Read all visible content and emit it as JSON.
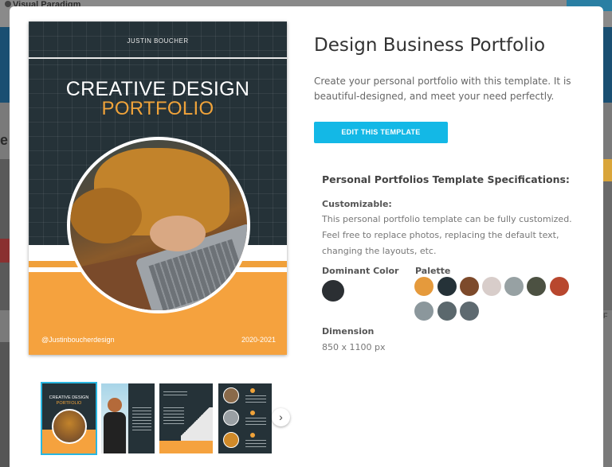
{
  "background": {
    "logo_text": "Visual Paradigm",
    "section_heading": "e",
    "right_card_label": "F"
  },
  "preview": {
    "author": "JUSTIN BOUCHER",
    "title_line1": "CREATIVE DESIGN",
    "title_line2": "PORTFOLIO",
    "handle": "@Justinboucherdesign",
    "year": "2020-2021"
  },
  "details": {
    "title": "Design Business Portfolio",
    "description": "Create your personal portfolio with this template. It is beautiful-designed, and meet your need perfectly.",
    "edit_button": "EDIT THIS TEMPLATE",
    "spec_title": "Personal Portfolios Template Specifications:",
    "customizable_label": "Customizable:",
    "customizable_text": "This personal portfolio template can be fully customized. Feel free to replace photos, replacing the default text, changing the layouts, etc.",
    "dominant_color_label": "Dominant Color",
    "dominant_color": "#2b2f33",
    "palette_label": "Palette",
    "palette": [
      "#e59a3c",
      "#253238",
      "#7d4a2b",
      "#d8cdca",
      "#97a1a3",
      "#4c5142",
      "#b8472e",
      "#8b979c",
      "#5b686d",
      "#5e6a70"
    ],
    "dimension_label": "Dimension",
    "dimension_value": "850 x 1100 px"
  },
  "thumbnails": {
    "t1_title1": "CREATIVE DESIGN",
    "t1_title2": "PORTFOLIO",
    "next_icon": "chevron-right-icon"
  }
}
